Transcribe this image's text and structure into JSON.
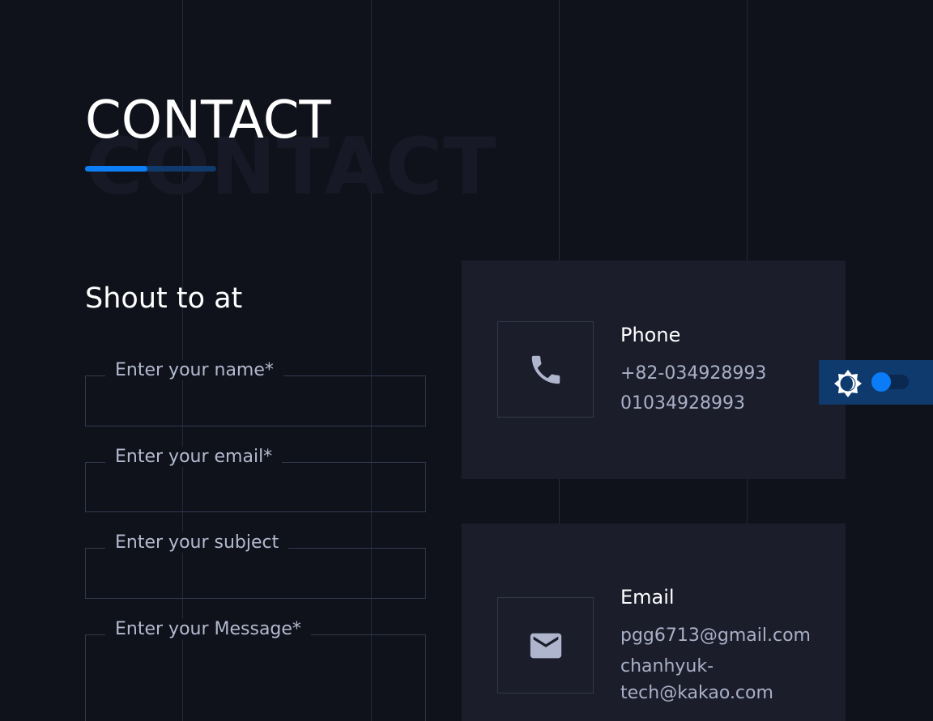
{
  "section": {
    "background_title": "CONTACT",
    "title": "CONTACT"
  },
  "form": {
    "heading": "Shout to at",
    "fields": [
      {
        "label": "Enter your name*",
        "value": ""
      },
      {
        "label": "Enter your email*",
        "value": ""
      },
      {
        "label": "Enter your subject",
        "value": ""
      },
      {
        "label": "Enter your Message*",
        "value": ""
      }
    ]
  },
  "cards": [
    {
      "title": "Phone",
      "icon": "phone-icon",
      "lines": [
        "+82-034928993",
        "01034928993"
      ]
    },
    {
      "title": "Email",
      "icon": "envelope-icon",
      "lines": [
        "pgg6713@gmail.com",
        "chanhyuk-",
        "tech@kakao.com"
      ]
    }
  ],
  "theme_toggle": {
    "icon": "brightness-icon",
    "state": "off"
  },
  "colors": {
    "background": "#10121b",
    "card": "#1b1d2b",
    "accent": "#0d7ef5",
    "accent_dark": "#0f3a6b",
    "text_primary": "#ffffff",
    "text_secondary": "#a9b0c6"
  }
}
